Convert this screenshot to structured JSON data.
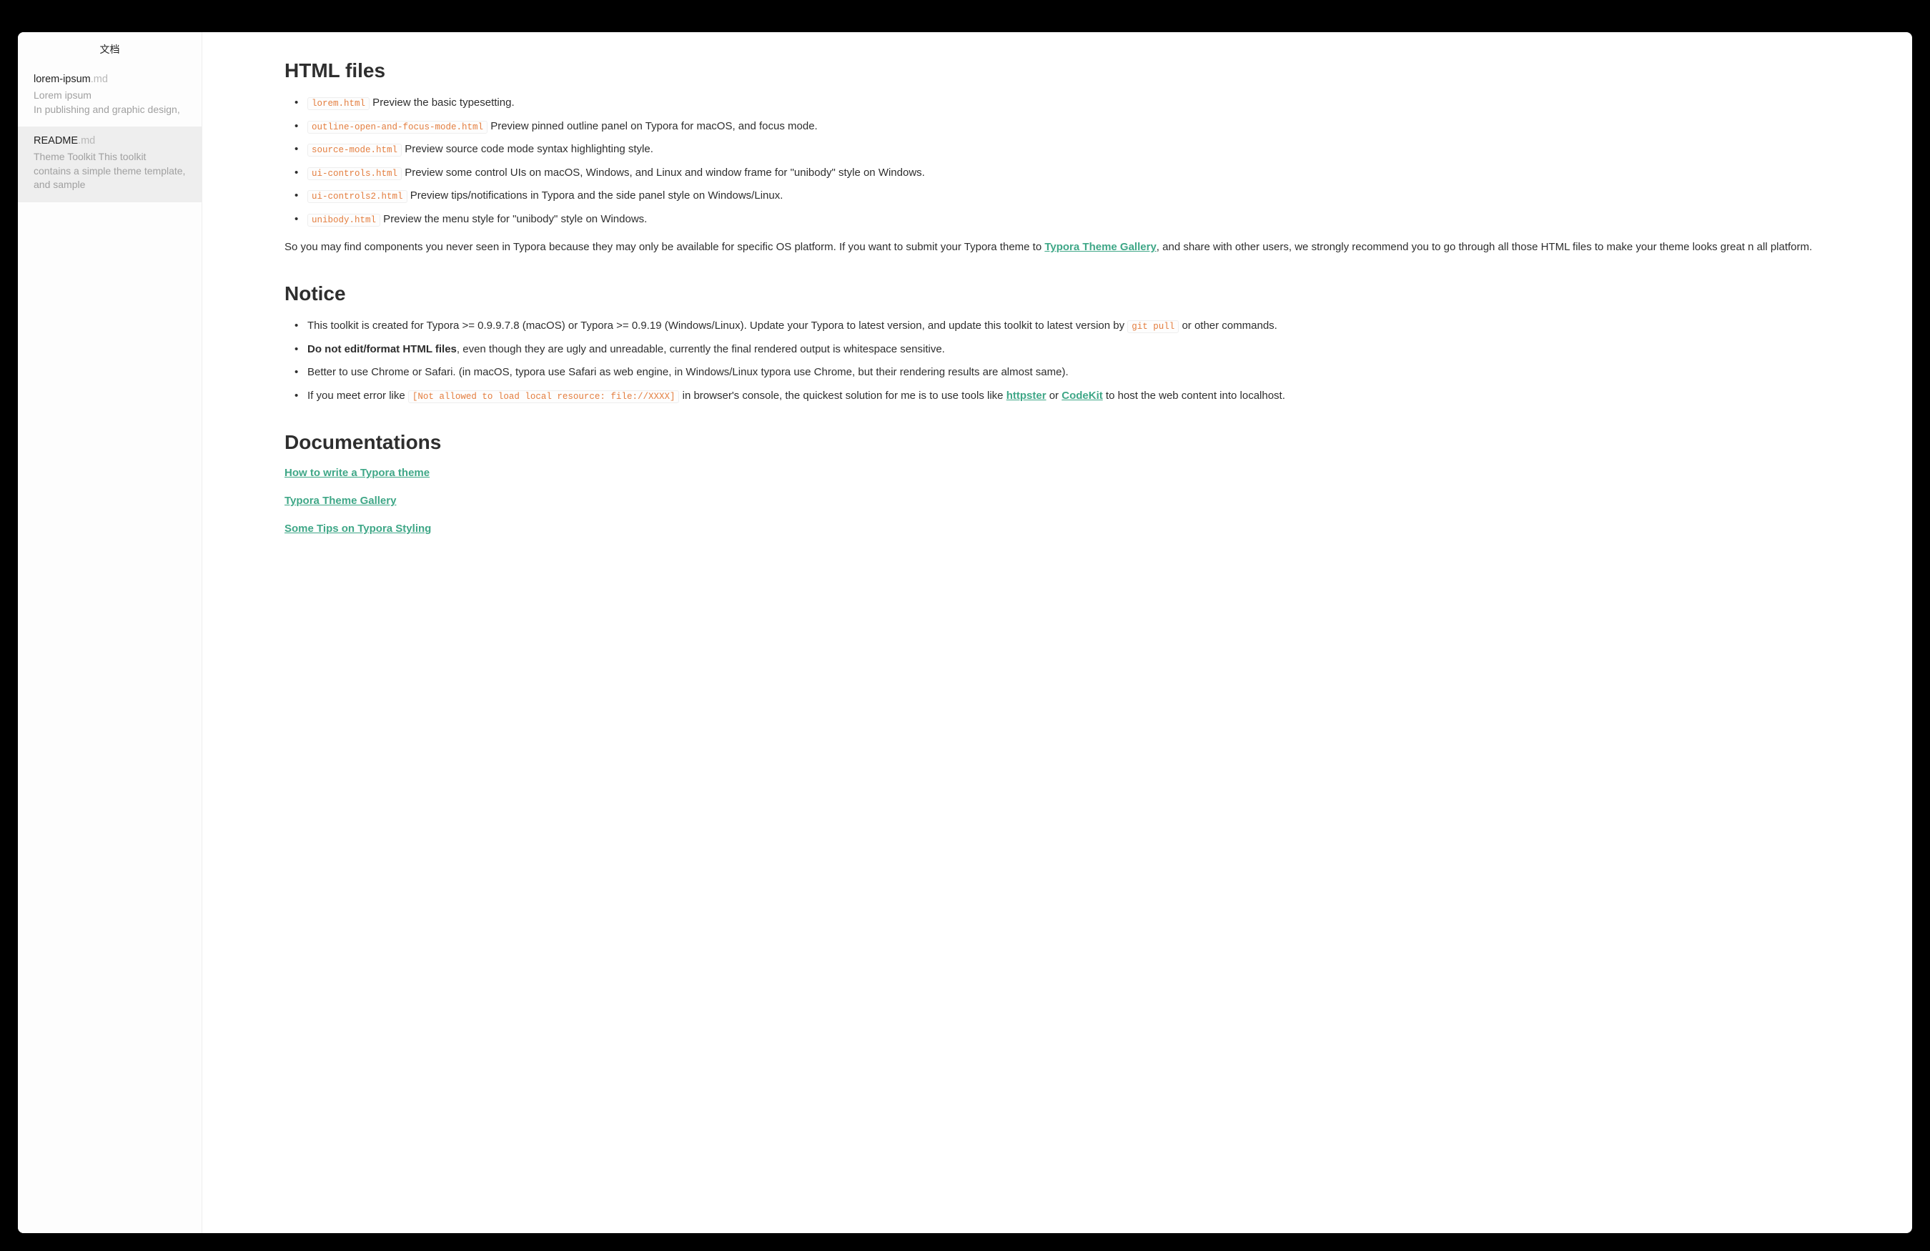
{
  "sidebar": {
    "header": "文档",
    "files": [
      {
        "name": "lorem-ipsum",
        "ext": ".md",
        "preview_line1": "Lorem ipsum",
        "preview_line2": "In publishing and graphic design,",
        "selected": false
      },
      {
        "name": "README",
        "ext": ".md",
        "preview": "Theme Toolkit This toolkit contains a simple theme template, and sample",
        "selected": true
      }
    ]
  },
  "content": {
    "section_html_files": {
      "heading": "HTML files",
      "items": [
        {
          "code": "lorem.html",
          "desc": " Preview the basic typesetting."
        },
        {
          "code": "outline-open-and-focus-mode.html",
          "desc": " Preview pinned outline panel on Typora for macOS, and focus mode."
        },
        {
          "code": "source-mode.html",
          "desc": " Preview source code mode syntax highlighting style."
        },
        {
          "code": "ui-controls.html",
          "desc": " Preview some control UIs on macOS, Windows, and Linux and window frame for \"unibody\"  style on Windows."
        },
        {
          "code": "ui-controls2.html",
          "desc": " Preview tips/notifications in Typora and the side panel style on Windows/Linux."
        },
        {
          "code": "unibody.html",
          "desc": " Preview the menu style for \"unibody\"  style on Windows."
        }
      ],
      "para_before": "So you may find components you never seen in Typora because they may only be available for specific OS platform. If you want to submit your Typora theme to ",
      "para_link": "Typora Theme Gallery",
      "para_after": ", and share with other users, we strongly recommend you to go through all those HTML files to make your theme looks great n all platform."
    },
    "section_notice": {
      "heading": "Notice",
      "item1_before": "This toolkit is created for Typora >= 0.9.9.7.8 (macOS) or Typora >= 0.9.19 (Windows/Linux). Update your Typora to latest version, and update this toolkit to latest version by ",
      "item1_code": "git pull",
      "item1_after": " or other commands.",
      "item2_bold": "Do not edit/format HTML files",
      "item2_after": ", even though they are ugly and unreadable, currently the final rendered output is whitespace sensitive.",
      "item3": "Better to use Chrome or Safari. (in macOS, typora use Safari as web engine, in Windows/Linux typora use Chrome, but their rendering results are almost same).",
      "item4_before": "If you meet error like ",
      "item4_code": "[Not allowed to load local resource: file://XXXX]",
      "item4_mid1": " in browser's console, the quickest solution for me is to use tools like ",
      "item4_link1": "httpster",
      "item4_mid2": " or ",
      "item4_link2": "CodeKit",
      "item4_after": " to host the web content into localhost."
    },
    "section_docs": {
      "heading": "Documentations",
      "links": [
        "How to write a Typora theme",
        "Typora Theme Gallery",
        "Some Tips on Typora Styling"
      ]
    }
  }
}
